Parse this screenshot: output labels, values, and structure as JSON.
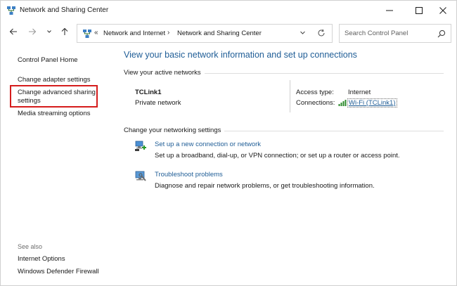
{
  "window": {
    "title": "Network and Sharing Center",
    "title_icon": "network-center-icon",
    "controls": [
      "minimize-icon",
      "maximize-icon",
      "close-icon"
    ]
  },
  "nav": {
    "back_icon": "arrow-left-icon",
    "forward_icon": "arrow-right-icon",
    "recent_icon": "chevron-down-icon",
    "up_icon": "arrow-up-icon"
  },
  "address": {
    "overflow": "«",
    "crumbs": [
      "Network and Internet",
      "Network and Sharing Center"
    ],
    "separator": "›",
    "dropdown_icon": "chevron-down-icon",
    "refresh_icon": "refresh-icon"
  },
  "search": {
    "placeholder": "Search Control Panel",
    "value": "",
    "icon": "search-icon"
  },
  "left_pane": {
    "home": "Control Panel Home",
    "links": [
      "Change adapter settings",
      "Change advanced sharing settings",
      "Media streaming options"
    ],
    "highlighted_index": 1,
    "highlight_color": "#d51c1c",
    "see_also_label": "See also",
    "see_also": [
      "Internet Options",
      "Windows Defender Firewall"
    ]
  },
  "main": {
    "title": "View your basic network information and set up connections",
    "active_networks_header": "View your active networks",
    "network": {
      "name": "TCLink1",
      "type": "Private network",
      "access_type_label": "Access type:",
      "access_type_value": "Internet",
      "connections_label": "Connections:",
      "connections_value": "Wi-Fi (TCLink1)",
      "connections_icon": "wifi-signal-icon"
    },
    "change_settings_header": "Change your networking settings",
    "tasks": [
      {
        "icon": "new-connection-icon",
        "link": "Set up a new connection or network",
        "desc": "Set up a broadband, dial-up, or VPN connection; or set up a router or access point."
      },
      {
        "icon": "troubleshoot-icon",
        "link": "Troubleshoot problems",
        "desc": "Diagnose and repair network problems, or get troubleshooting information."
      }
    ]
  },
  "colors": {
    "link": "#1f5d96",
    "title": "#1f5d96",
    "highlight_box": "#d51c1c",
    "text": "#1a1a1a"
  }
}
